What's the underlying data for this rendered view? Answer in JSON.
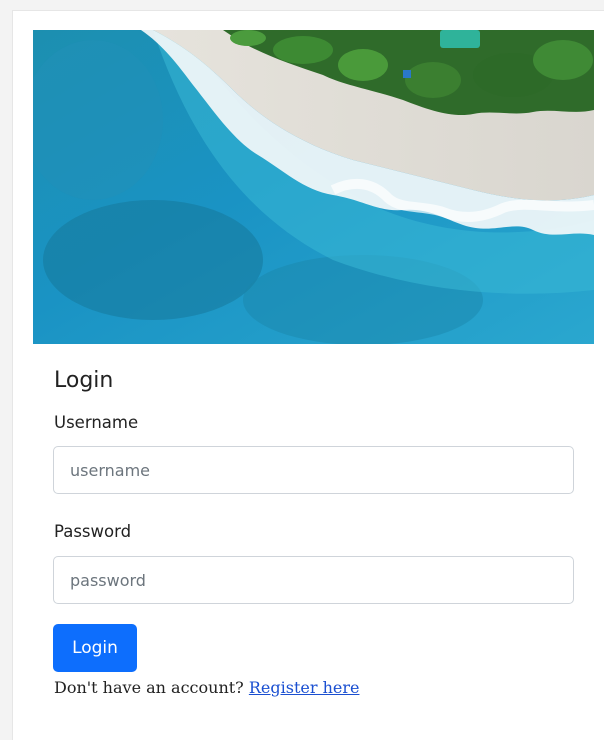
{
  "login": {
    "title": "Login",
    "username_label": "Username",
    "username_placeholder": "username",
    "username_value": "",
    "password_label": "Password",
    "password_placeholder": "password",
    "password_value": "",
    "submit_label": "Login",
    "footer_text": "Don't have an account?",
    "register_link": "Register here"
  },
  "colors": {
    "primary": "#0d6efd",
    "link": "#1a4fd1"
  }
}
